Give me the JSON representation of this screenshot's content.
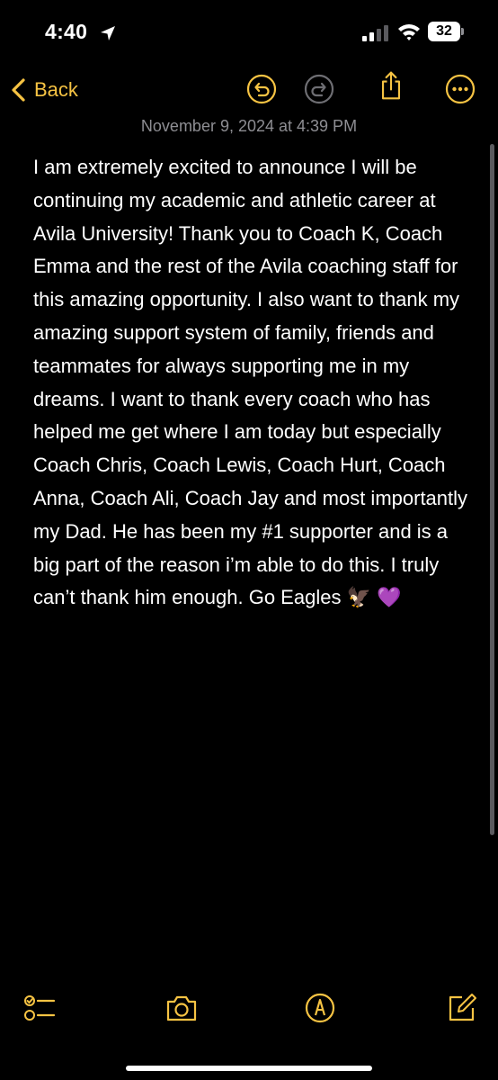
{
  "status_bar": {
    "time": "4:40",
    "battery": "32",
    "icons": [
      "location-arrow-icon",
      "cellular-signal-icon",
      "wifi-icon",
      "battery-icon"
    ]
  },
  "nav": {
    "back_label": "Back",
    "icons": [
      "undo-icon",
      "redo-icon",
      "share-icon",
      "more-icon"
    ]
  },
  "note": {
    "date": "November 9, 2024 at 4:39 PM",
    "body": "I am extremely excited to announce I will be continuing my academic and athletic career at Avila University! Thank you to Coach K, Coach Emma and the rest of the Avila coaching staff for this amazing opportunity. I also want to thank my amazing support system of family, friends and teammates for always supporting me in my dreams. I want to thank every coach who has helped me get where I am today but especially Coach Chris, Coach Lewis, Coach Hurt, Coach Anna, Coach Ali, Coach Jay and most importantly my Dad. He has been my #1 supporter and is a big part of the reason i’m able to do this. I truly can’t thank him enough. Go Eagles 🦅 💜"
  },
  "toolbar": {
    "icons": [
      "checklist-icon",
      "camera-icon",
      "markup-icon",
      "compose-icon"
    ]
  },
  "colors": {
    "accent": "#f6c343",
    "background": "#000000",
    "text": "#ffffff",
    "secondary_text": "#8e8e93"
  }
}
